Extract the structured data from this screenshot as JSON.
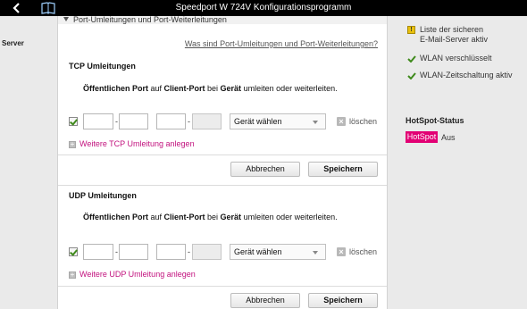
{
  "window": {
    "title": "Speedport W 724V Konfigurationsprogramm"
  },
  "left": {
    "server_label": "Server"
  },
  "section": {
    "title": "Port-Umleitungen und Port-Weiterleitungen",
    "help_link": "Was sind Port-Umleitungen und Port-Weiterleitungen?"
  },
  "tcp": {
    "title": "TCP Umleitungen",
    "desc_a": "Öffentlichen Port",
    "desc_b": " auf ",
    "desc_c": "Client-Port",
    "desc_d": " bei ",
    "desc_e": "Gerät",
    "desc_f": " umleiten oder weiterleiten.",
    "rule": {
      "enabled": true,
      "public_from": "",
      "public_to": "",
      "client_from": "",
      "client_to": "",
      "device_placeholder": "Gerät wählen",
      "delete_label": "löschen",
      "separator": "-"
    },
    "add_link": "Weitere TCP Umleitung anlegen",
    "cancel": "Abbrechen",
    "save": "Speichern"
  },
  "udp": {
    "title": "UDP Umleitungen",
    "desc_a": "Öffentlichen Port",
    "desc_b": " auf ",
    "desc_c": "Client-Port",
    "desc_d": " bei ",
    "desc_e": "Gerät",
    "desc_f": " umleiten oder weiterleiten.",
    "rule": {
      "enabled": true,
      "public_from": "",
      "public_to": "",
      "client_from": "",
      "client_to": "",
      "device_placeholder": "Gerät wählen",
      "delete_label": "löschen",
      "separator": "-"
    },
    "add_link": "Weitere UDP Umleitung anlegen",
    "cancel": "Abbrechen",
    "save": "Speichern"
  },
  "status": {
    "items": [
      {
        "icon": "warning-icon",
        "line1": "Liste der sicheren",
        "line2": "E-Mail-Server aktiv"
      },
      {
        "icon": "check-icon",
        "line1": "WLAN verschlüsselt"
      },
      {
        "icon": "check-icon",
        "line1": "WLAN-Zeitschaltung aktiv"
      }
    ],
    "hotspot_title": "HotSpot-Status",
    "hotspot_badge": "HotSpot",
    "hotspot_value": "Aus"
  },
  "colors": {
    "brand_magenta": "#e20074",
    "link_magenta": "#c2127e",
    "check_green": "#3f8a1c",
    "warning_yellow": "#e9c10e"
  }
}
